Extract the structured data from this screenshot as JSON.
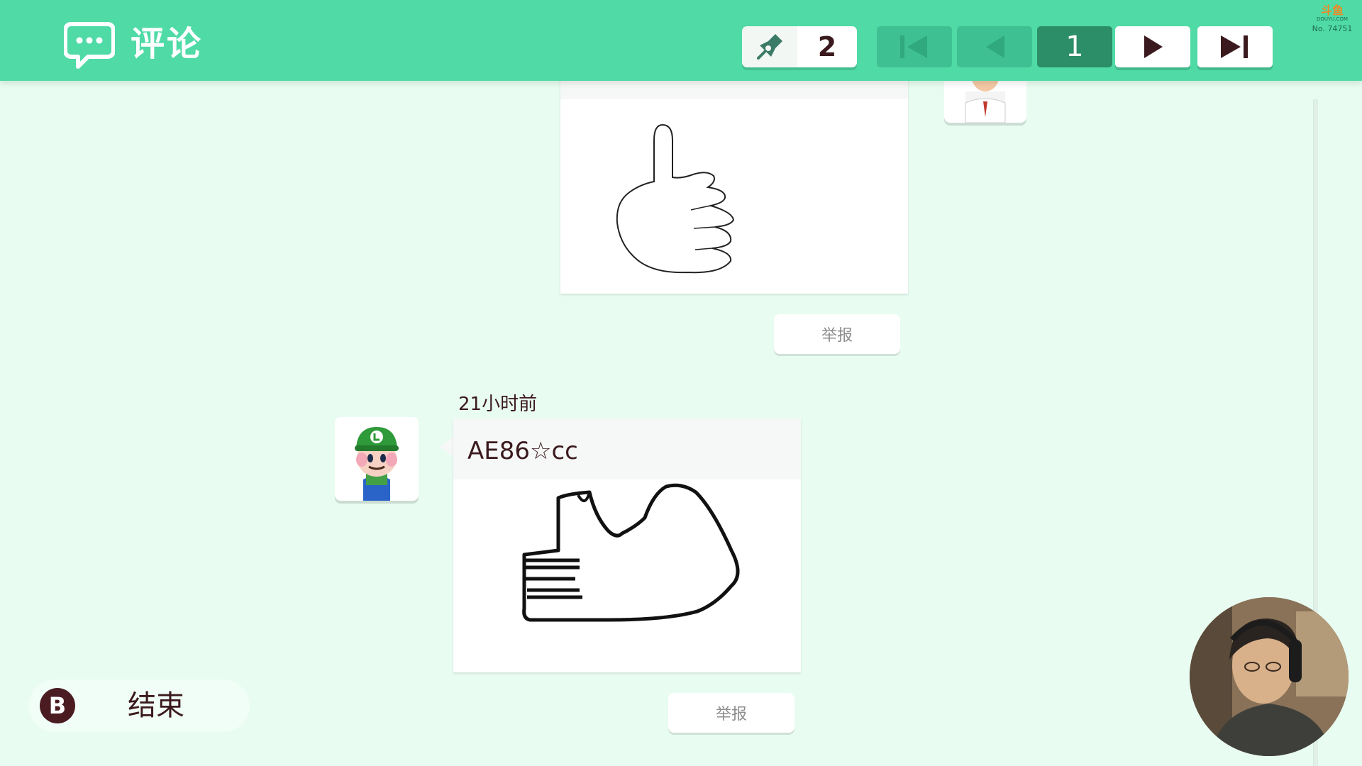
{
  "header": {
    "title": "评论",
    "comment_count": "2",
    "page_number": "1",
    "watermark": {
      "brand": "斗鱼",
      "site": "DOUYU.COM",
      "room": "No. 74751"
    }
  },
  "comments": [
    {
      "user": "",
      "report_label": "举报"
    },
    {
      "timestamp": "21小时前",
      "user": "AE86☆cc",
      "report_label": "举报"
    }
  ],
  "footer": {
    "button_key": "B",
    "end_label": "结束"
  },
  "colors": {
    "header_bg": "#4fdaa6",
    "page_bg": "#e8fcf1",
    "text": "#3b1a1e",
    "page_box": "#2b8e69"
  },
  "icons": [
    "comment-bubble-icon",
    "stamp-tool-icon",
    "skip-first-icon",
    "prev-icon",
    "next-icon",
    "skip-last-icon"
  ]
}
